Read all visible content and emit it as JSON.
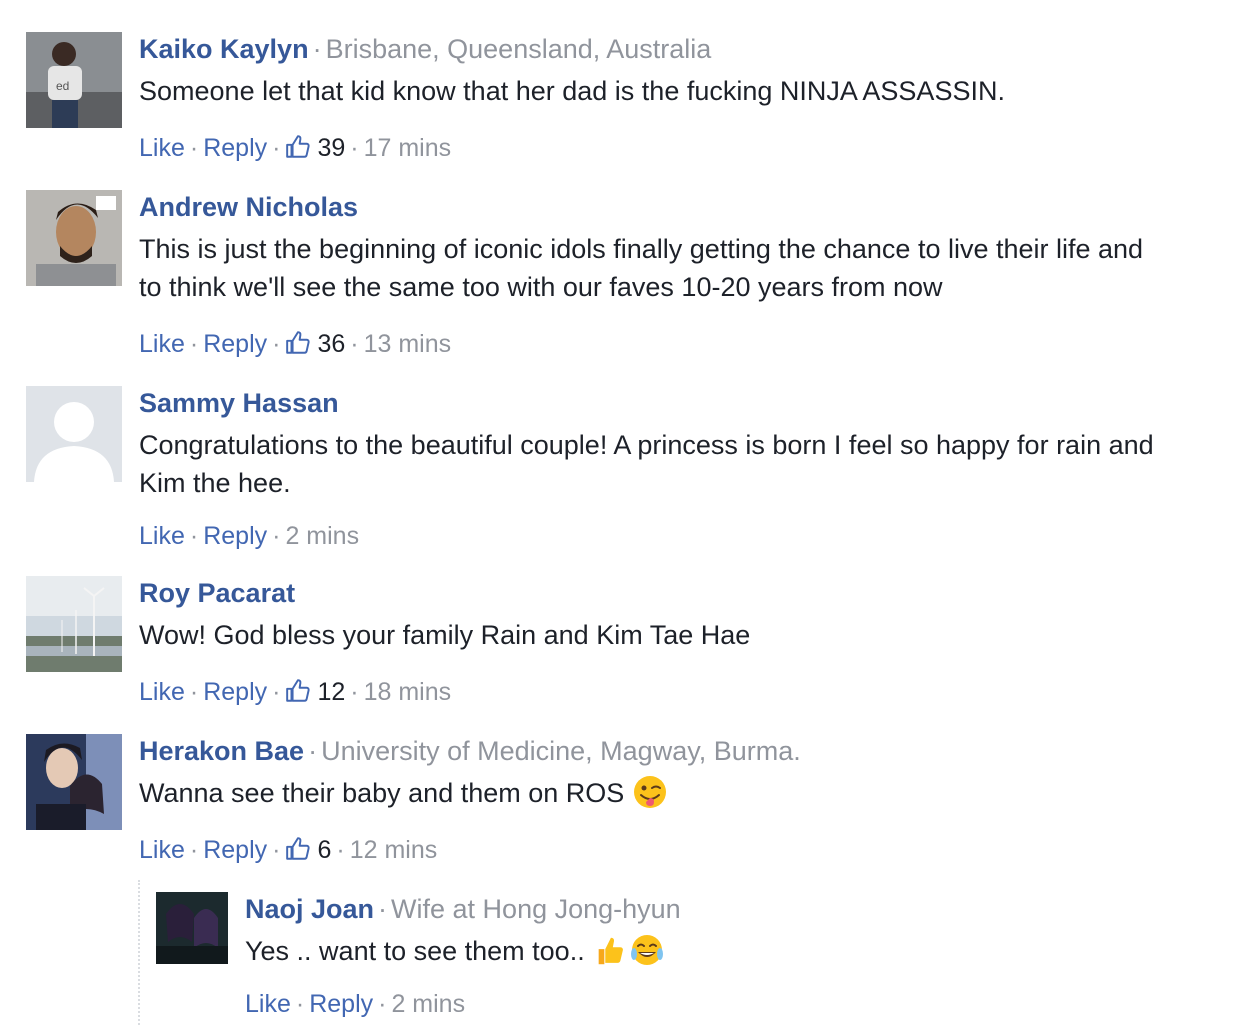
{
  "comments": [
    {
      "author": "Kaiko Kaylyn",
      "affiliation": "Brisbane, Queensland, Australia",
      "text": "Someone let that kid know that her dad is the fucking NINJA ASSASSIN.",
      "like_label": "Like",
      "reply_label": "Reply",
      "likes": "39",
      "time": "17 mins"
    },
    {
      "author": "Andrew Nicholas",
      "text_line1": "This is just the beginning of iconic idols finally getting the chance to live their life and",
      "text_line2": "to think we'll see the same too with our faves 10-20 years from now",
      "like_label": "Like",
      "reply_label": "Reply",
      "likes": "36",
      "time": "13 mins"
    },
    {
      "author": "Sammy Hassan",
      "text_line1": "Congratulations to the beautiful couple! A princess is born I feel so happy for rain and",
      "text_line2": "Kim the hee.",
      "like_label": "Like",
      "reply_label": "Reply",
      "time": "2 mins"
    },
    {
      "author": "Roy Pacarat",
      "text": "Wow! God bless your family Rain and Kim Tae Hae",
      "like_label": "Like",
      "reply_label": "Reply",
      "likes": "12",
      "time": "18 mins"
    },
    {
      "author": "Herakon Bae",
      "affiliation": "University of Medicine, Magway, Burma.",
      "text": "Wanna see their baby and them on ROS",
      "emoji": "winking-tongue-emoji",
      "like_label": "Like",
      "reply_label": "Reply",
      "likes": "6",
      "time": "12 mins"
    }
  ],
  "reply": {
    "author": "Naoj Joan",
    "affiliation": "Wife at Hong Jong-hyun",
    "text": "Yes .. want to see them too..",
    "emojis": [
      "thumbs-up-emoji",
      "tears-of-joy-emoji"
    ],
    "like_label": "Like",
    "reply_label": "Reply",
    "time": "2 mins"
  },
  "separator": "·",
  "colors": {
    "author": "#365899",
    "link": "#4267b2",
    "muted": "#90949c",
    "text": "#1d2129"
  }
}
